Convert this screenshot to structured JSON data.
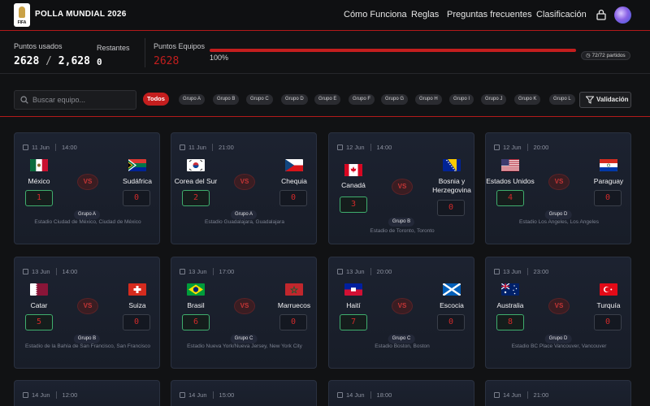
{
  "header": {
    "brand": "POLLA MUNDIAL 2026",
    "logo_text": "FIFA",
    "nav": [
      "Cómo Funciona",
      "Reglas",
      "Preguntas frecuentes",
      "Clasificación"
    ]
  },
  "stats": {
    "used_label": "Puntos usados",
    "used_value": "2628",
    "used_sep": "/",
    "used_total": "2,628",
    "remaining_label": "Restantes",
    "remaining_value": "0",
    "teams_label": "Puntos Equipos",
    "teams_value": "2628",
    "progress_percent": 100,
    "progress_label": "100%",
    "matches_label": "72/72 partidos"
  },
  "filters": {
    "search_placeholder": "Buscar equipo...",
    "chips": [
      "Todos",
      "Grupo A",
      "Grupo B",
      "Grupo C",
      "Grupo D",
      "Grupo E",
      "Grupo F",
      "Grupo G",
      "Grupo H",
      "Grupo I",
      "Grupo J",
      "Grupo K",
      "Grupo L"
    ],
    "active_chip": "Todos",
    "validation_label": "Validación"
  },
  "vs_label": "VS",
  "matches": [
    {
      "date": "11 Jun",
      "time": "14:00",
      "home": "México",
      "away": "Sudáfrica",
      "home_flag": "mexico",
      "away_flag": "south-africa",
      "home_score": "1",
      "away_score": "0",
      "group": "Grupo A",
      "venue": "Estadio Ciudad de México, Ciudad de México"
    },
    {
      "date": "11 Jun",
      "time": "21:00",
      "home": "Corea del Sur",
      "away": "Chequia",
      "home_flag": "south-korea",
      "away_flag": "czechia",
      "home_score": "2",
      "away_score": "0",
      "group": "Grupo A",
      "venue": "Estadio Guadalajara, Guadalajara"
    },
    {
      "date": "12 Jun",
      "time": "14:00",
      "home": "Canadá",
      "away": "Bosnia y Herzegovina",
      "home_flag": "canada",
      "away_flag": "bosnia",
      "home_score": "3",
      "away_score": "0",
      "group": "Grupo B",
      "venue": "Estadio de Toronto, Toronto"
    },
    {
      "date": "12 Jun",
      "time": "20:00",
      "home": "Estados Unidos",
      "away": "Paraguay",
      "home_flag": "usa",
      "away_flag": "paraguay",
      "home_score": "4",
      "away_score": "0",
      "group": "Grupo D",
      "venue": "Estadio Los Angeles, Los Angeles"
    },
    {
      "date": "13 Jun",
      "time": "14:00",
      "home": "Catar",
      "away": "Suiza",
      "home_flag": "qatar",
      "away_flag": "switzerland",
      "home_score": "5",
      "away_score": "0",
      "group": "Grupo B",
      "venue": "Estadio de la Bahía de San Francisco, San Francisco"
    },
    {
      "date": "13 Jun",
      "time": "17:00",
      "home": "Brasil",
      "away": "Marruecos",
      "home_flag": "brazil",
      "away_flag": "morocco",
      "home_score": "6",
      "away_score": "0",
      "group": "Grupo C",
      "venue": "Estadio Nueva York/Nueva Jersey, New York City"
    },
    {
      "date": "13 Jun",
      "time": "20:00",
      "home": "Haití",
      "away": "Escocia",
      "home_flag": "haiti",
      "away_flag": "scotland",
      "home_score": "7",
      "away_score": "0",
      "group": "Grupo C",
      "venue": "Estadio Boston, Boston"
    },
    {
      "date": "13 Jun",
      "time": "23:00",
      "home": "Australia",
      "away": "Turquía",
      "home_flag": "australia",
      "away_flag": "turkey",
      "home_score": "8",
      "away_score": "0",
      "group": "Grupo D",
      "venue": "Estadio BC Place Vancouver, Vancouver"
    },
    {
      "date": "14 Jun",
      "time": "12:00"
    },
    {
      "date": "14 Jun",
      "time": "15:00"
    },
    {
      "date": "14 Jun",
      "time": "18:00"
    },
    {
      "date": "14 Jun",
      "time": "21:00"
    }
  ]
}
